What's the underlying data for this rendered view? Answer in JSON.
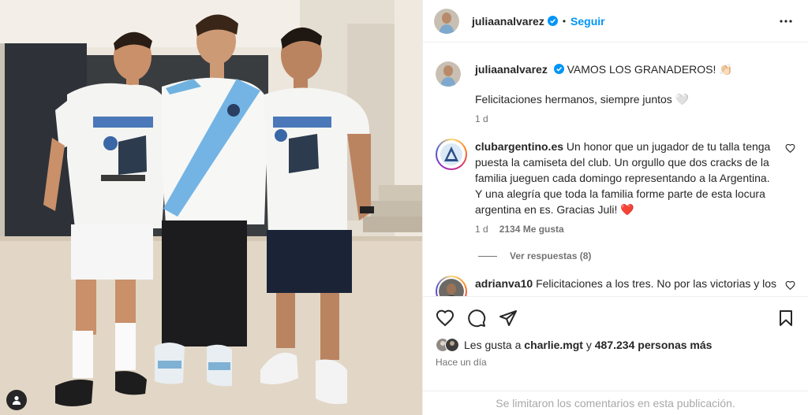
{
  "post": {
    "author": "juliaanalvarez",
    "follow_label": "Seguir",
    "separator": "•"
  },
  "caption": {
    "username": "juliaanalvarez",
    "text": "VAMOS LOS GRANADEROS! 👏🏻",
    "line2": "Felicitaciones hermanos, siempre juntos 🤍",
    "time": "1 d"
  },
  "comments": [
    {
      "username": "clubargentino.es",
      "text": "Un honor que un jugador de tu talla tenga puesta la camiseta del club. Un orgullo que dos cracks de la familia jueguen cada domingo representando a la Argentina. Y una alegría que toda la familia forme parte de esta locura argentina en ᴇs. Gracias Juli! ❤️",
      "time": "1 d",
      "likes": "2134 Me gusta",
      "replies": "Ver respuestas (8)"
    },
    {
      "username": "adrianva10",
      "text": "Felicitaciones a los tres. No por las victorias y los"
    }
  ],
  "likes": {
    "prefix": "Les gusta a ",
    "user": "charlie.mgt",
    "mid": " y ",
    "count": "487.234 personas más"
  },
  "timestamp": "Hace un día",
  "comments_limited": "Se limitaron los comentarios en esta publicación.",
  "icons": {
    "like": "heart-icon",
    "comment": "comment-icon",
    "share": "share-icon",
    "save": "bookmark-icon",
    "more": "more-horizontal-icon",
    "user_tag": "user-tag-icon"
  },
  "colors": {
    "accent": "#0095f6",
    "verified": "#0095f6",
    "secondary_text": "#737373",
    "heart_red": "#ed4956"
  }
}
